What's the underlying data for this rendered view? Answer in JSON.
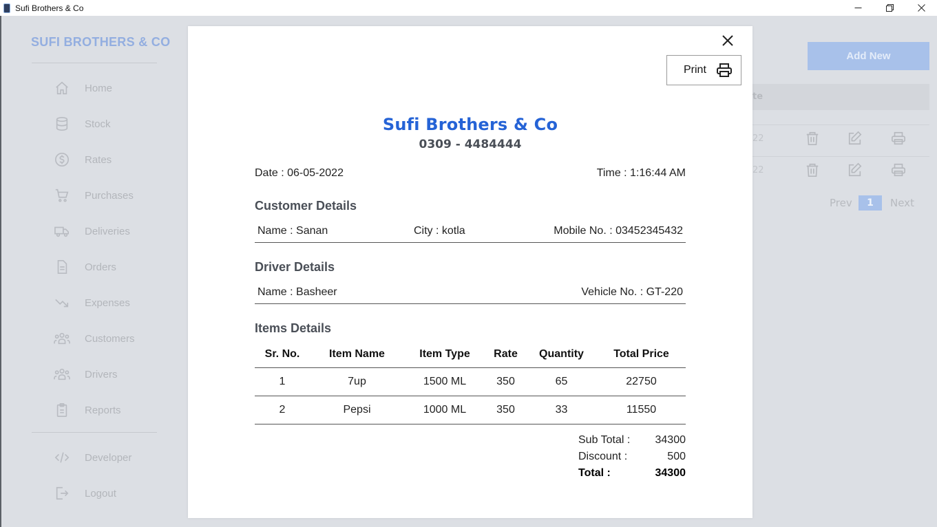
{
  "window": {
    "title": "Sufi Brothers & Co"
  },
  "sidebar": {
    "brand": "SUFI BROTHERS & CO",
    "items": [
      {
        "label": "Home",
        "icon": "home-icon"
      },
      {
        "label": "Stock",
        "icon": "database-icon"
      },
      {
        "label": "Rates",
        "icon": "dollar-circle-icon"
      },
      {
        "label": "Purchases",
        "icon": "cart-icon"
      },
      {
        "label": "Deliveries",
        "icon": "truck-icon"
      },
      {
        "label": "Orders",
        "icon": "document-icon"
      },
      {
        "label": "Expenses",
        "icon": "trend-down-icon"
      },
      {
        "label": "Customers",
        "icon": "users-icon"
      },
      {
        "label": "Drivers",
        "icon": "users-icon"
      },
      {
        "label": "Reports",
        "icon": "clipboard-icon"
      }
    ],
    "footer_items": [
      {
        "label": "Developer",
        "icon": "code-icon"
      },
      {
        "label": "Logout",
        "icon": "logout-icon"
      }
    ]
  },
  "background": {
    "add_new_label": "Add New",
    "table_header_fragment": "te",
    "row_fragments": [
      "22",
      "22"
    ],
    "pagination": {
      "prev": "Prev",
      "current": "1",
      "next": "Next"
    }
  },
  "modal": {
    "print_label": "Print",
    "company_name": "Sufi Brothers & Co",
    "phone": "0309 - 4484444",
    "date": "Date : 06-05-2022",
    "time": "Time : 1:16:44 AM",
    "customer": {
      "title": "Customer Details",
      "name": "Name : Sanan",
      "city": "City : kotla",
      "mobile": "Mobile No. : 03452345432"
    },
    "driver": {
      "title": "Driver Details",
      "name": "Name : Basheer",
      "vehicle": "Vehicle No. : GT-220"
    },
    "items": {
      "title": "Items Details",
      "columns": [
        "Sr. No.",
        "Item Name",
        "Item Type",
        "Rate",
        "Quantity",
        "Total Price"
      ],
      "rows": [
        [
          "1",
          "7up",
          "1500 ML",
          "350",
          "65",
          "22750"
        ],
        [
          "2",
          "Pepsi",
          "1000 ML",
          "350",
          "33",
          "11550"
        ]
      ]
    },
    "totals": {
      "sub_total_label": "Sub Total :",
      "sub_total": "34300",
      "discount_label": "Discount :",
      "discount": "500",
      "total_label": "Total :",
      "total": "34300"
    }
  },
  "colors": {
    "brand_blue": "#2563d6",
    "muted_blue": "#a8c1ea",
    "overlay_bg": "#dcdfe4"
  }
}
